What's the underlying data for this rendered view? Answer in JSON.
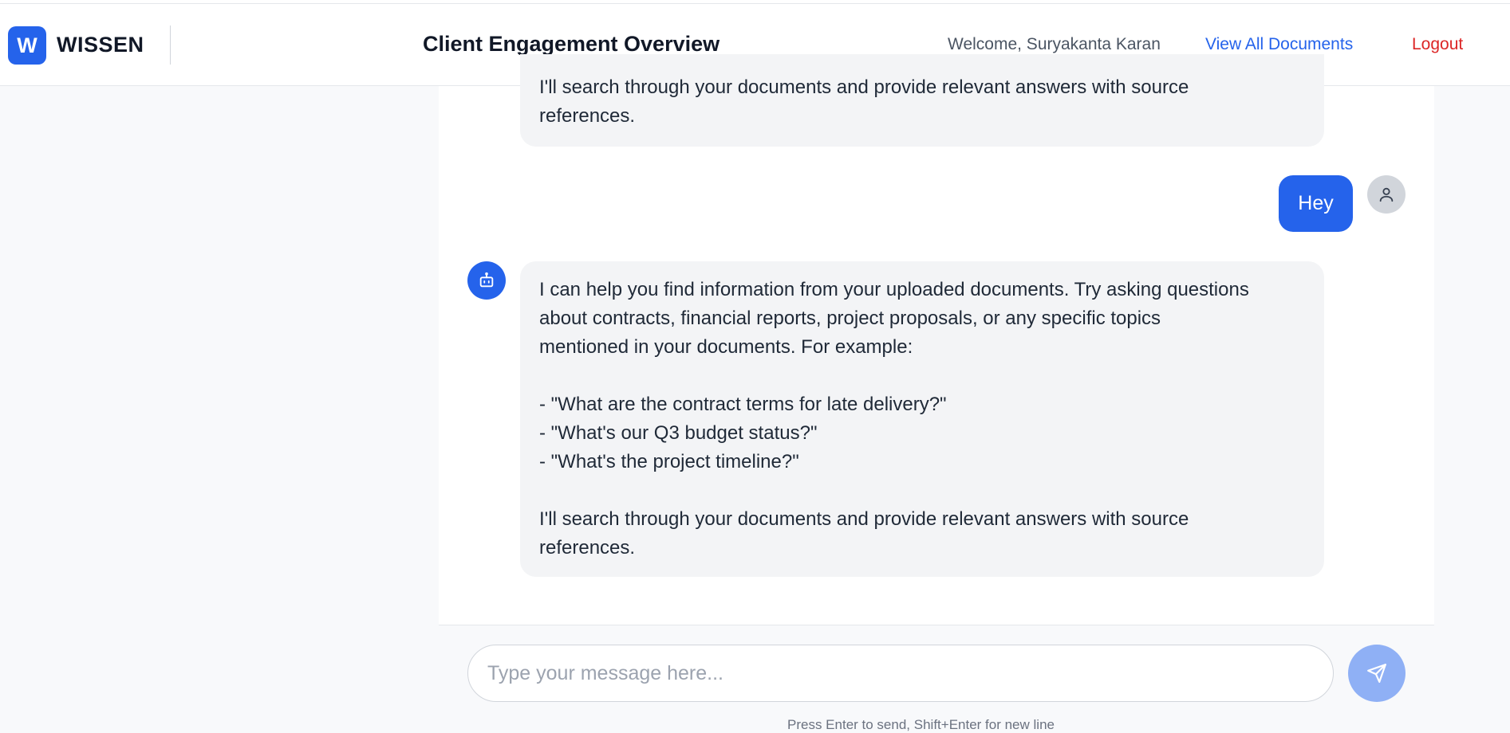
{
  "brand": {
    "badge": "W",
    "name": "WISSEN"
  },
  "header": {
    "title": "Client Engagement Overview",
    "welcome": "Welcome, Suryakanta Karan",
    "view_all": "View All Documents",
    "logout": "Logout"
  },
  "messages": [
    {
      "role": "assistant",
      "text": "I'll search through your documents and provide relevant answers with source\nreferences."
    },
    {
      "role": "user",
      "text": "Hey"
    },
    {
      "role": "assistant",
      "text": "I can help you find information from your uploaded documents. Try asking questions\nabout contracts, financial reports, project proposals, or any specific topics\nmentioned in your documents. For example:\n\n- \"What are the contract terms for late delivery?\"\n- \"What's our Q3 budget status?\"\n- \"What's the project timeline?\"\n\nI'll search through your documents and provide relevant answers with source\nreferences."
    }
  ],
  "composer": {
    "value": "",
    "placeholder": "Type your message here...",
    "hint": "Press Enter to send, Shift+Enter for new line"
  },
  "icons": {
    "user_avatar": "user-icon",
    "bot_avatar": "bot-icon",
    "send": "send-icon"
  },
  "colors": {
    "accent": "#2563eb",
    "logout": "#dc2626",
    "send_disabled": "#8fb0f5"
  }
}
